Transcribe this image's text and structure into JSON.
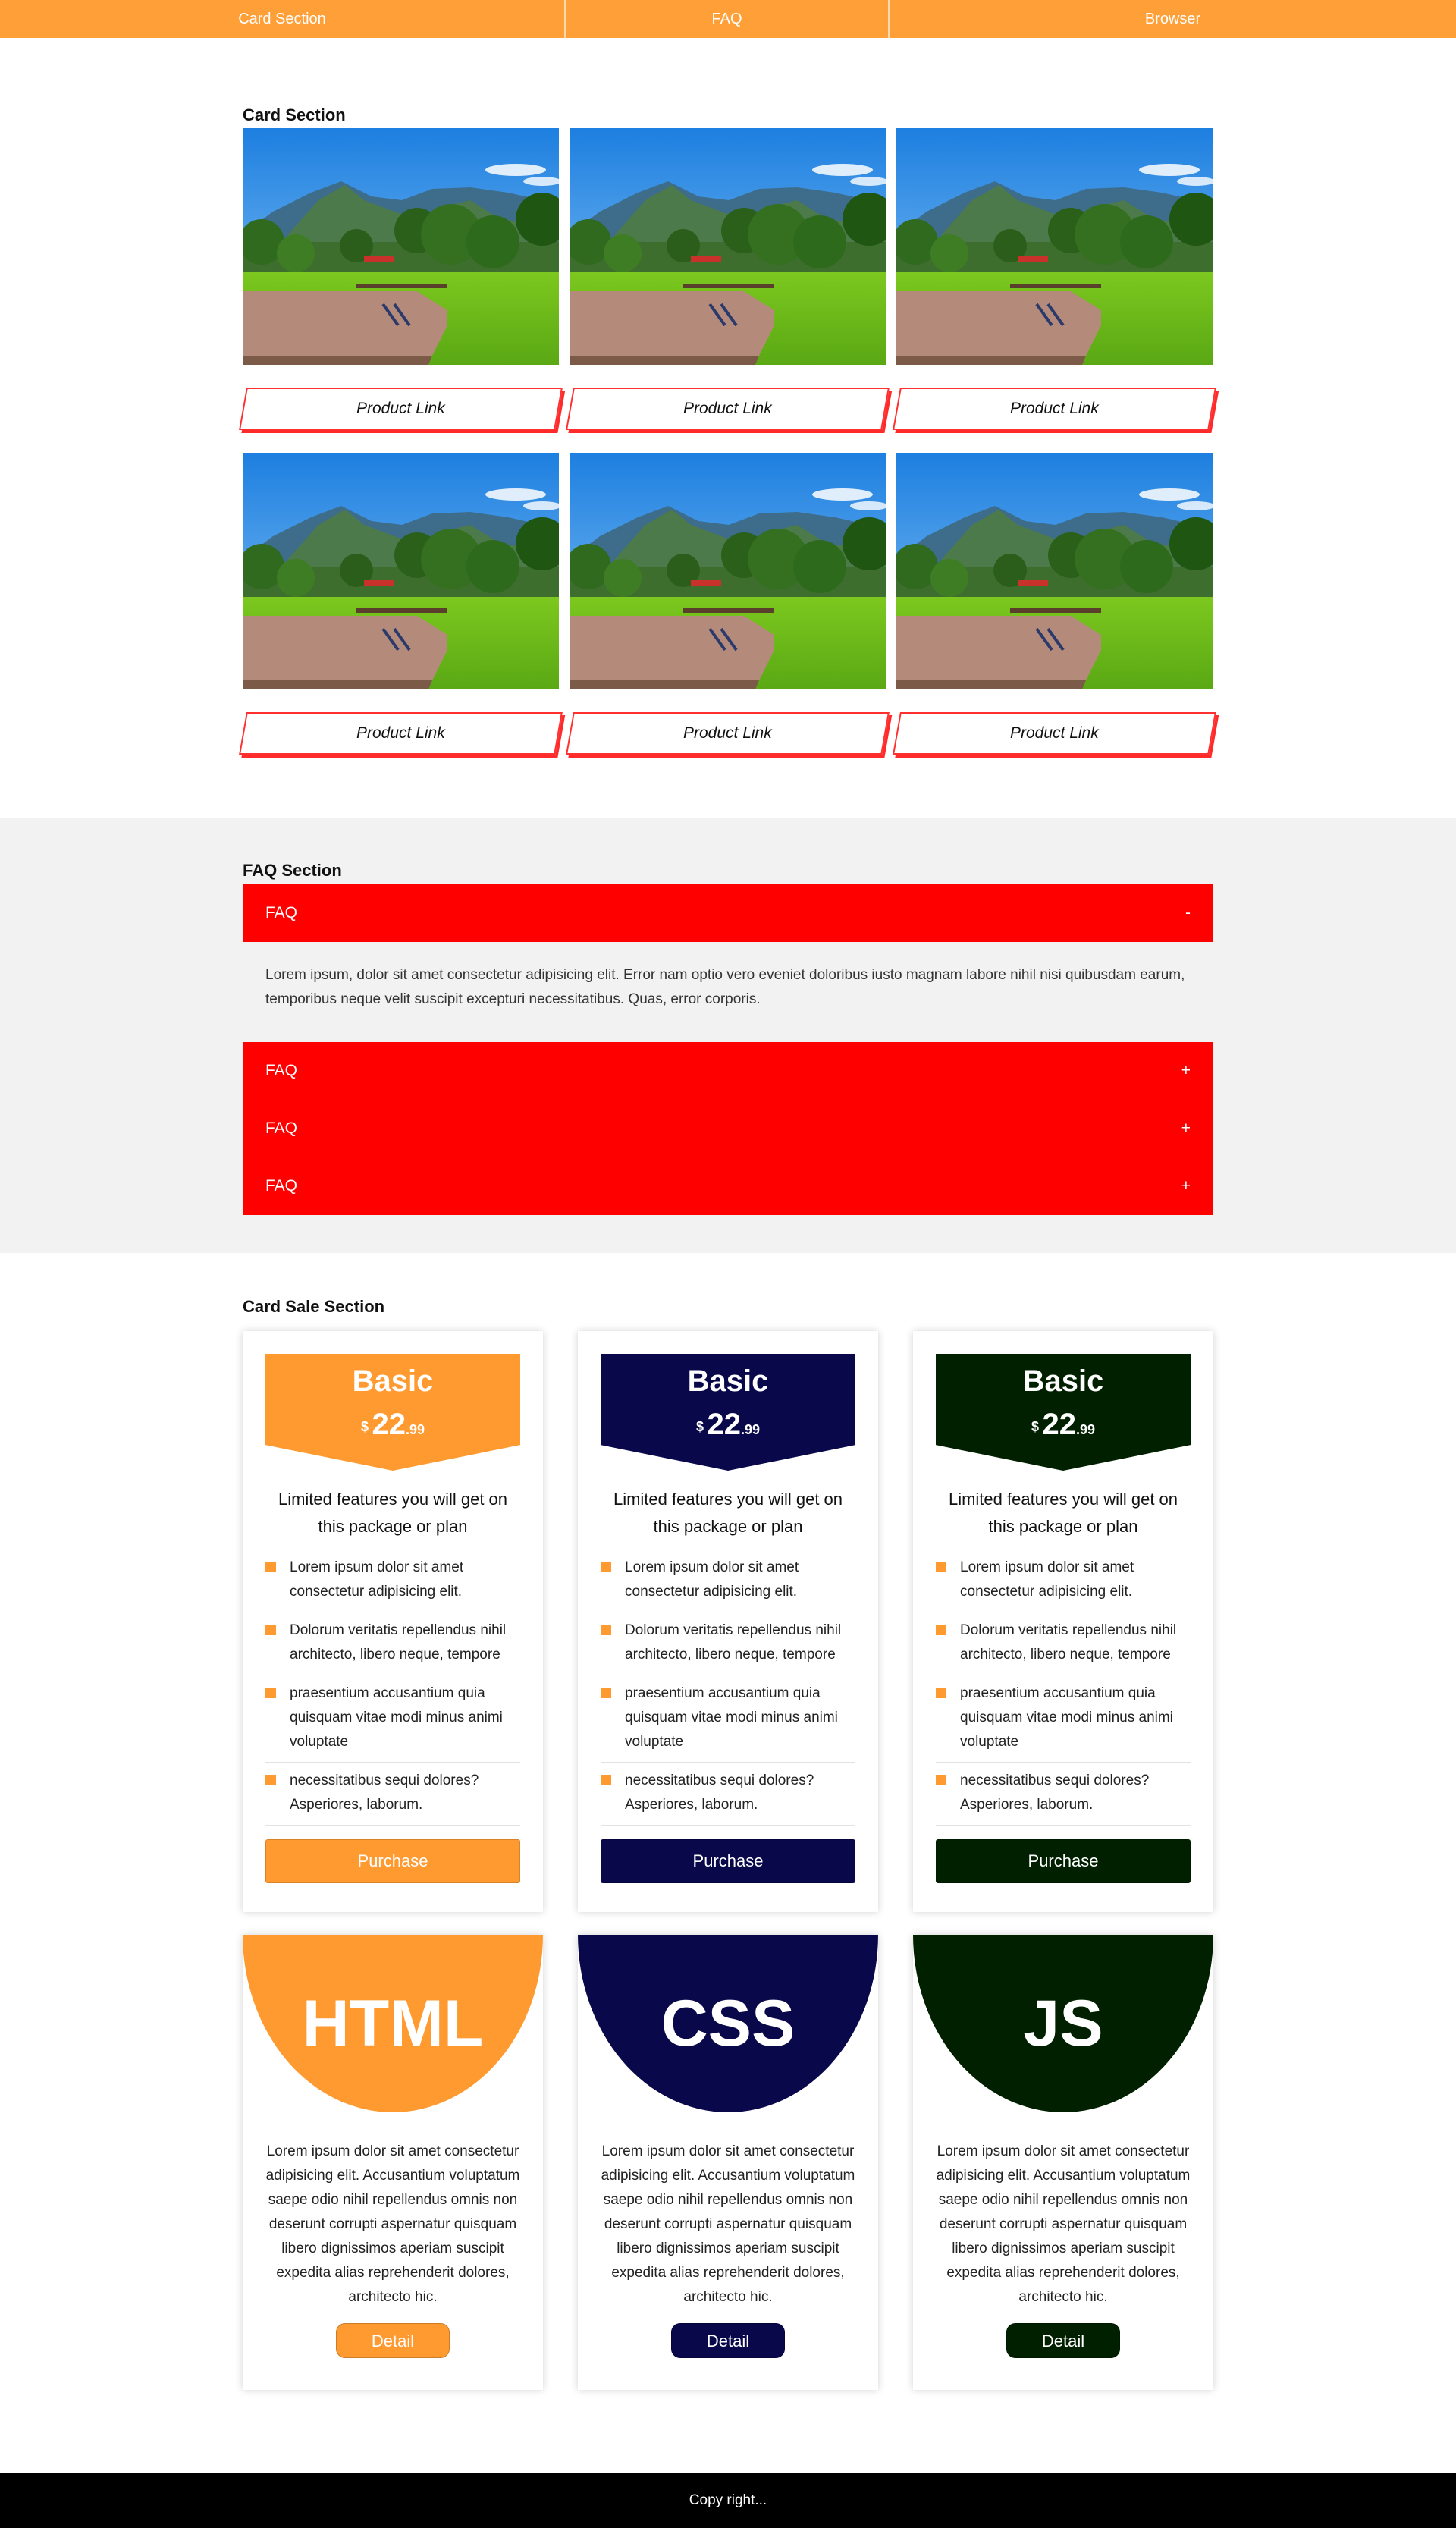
{
  "nav": {
    "items": [
      "Card Section",
      "FAQ",
      "Browser"
    ],
    "color": "#ff9f37"
  },
  "card_section": {
    "title": "Card Section",
    "link_label": "Product Link",
    "cards": [
      {
        "image": "mountain-park-landscape"
      },
      {
        "image": "mountain-park-landscape"
      },
      {
        "image": "mountain-park-landscape"
      },
      {
        "image": "mountain-park-landscape"
      },
      {
        "image": "mountain-park-landscape"
      },
      {
        "image": "mountain-park-landscape"
      }
    ]
  },
  "faq": {
    "title": "FAQ Section",
    "color": "#ff0000",
    "items": [
      {
        "q": "FAQ",
        "toggle": "-",
        "open": true,
        "answer": "Lorem ipsum, dolor sit amet consectetur adipisicing elit. Error nam optio vero eveniet doloribus iusto magnam labore nihil nisi quibusdam earum, temporibus neque velit suscipit excepturi necessitatibus. Quas, error corporis."
      },
      {
        "q": "FAQ",
        "toggle": "+",
        "open": false
      },
      {
        "q": "FAQ",
        "toggle": "+",
        "open": false
      },
      {
        "q": "FAQ",
        "toggle": "+",
        "open": false
      }
    ]
  },
  "sale": {
    "title": "Card Sale Section",
    "plans": [
      {
        "name": "Basic",
        "currency": "$",
        "price": "22",
        "cents": ".99",
        "color": "#ff9a30",
        "desc": "Limited features you will get on this package or plan",
        "button": "Purchase"
      },
      {
        "name": "Basic",
        "currency": "$",
        "price": "22",
        "cents": ".99",
        "color": "#08084a",
        "desc": "Limited features you will get on this package or plan",
        "button": "Purchase"
      },
      {
        "name": "Basic",
        "currency": "$",
        "price": "22",
        "cents": ".99",
        "color": "#002000",
        "desc": "Limited features you will get on this package or plan",
        "button": "Purchase"
      }
    ],
    "features": [
      "Lorem ipsum dolor sit amet consectetur adipisicing elit.",
      "Dolorum veritatis repellendus nihil architecto, libero neque, tempore",
      "praesentium accusantium quia quisquam vitae modi minus animi voluptate",
      "necessitatibus sequi dolores? Asperiores, laborum."
    ],
    "feature_bullet_color": "#ff9a30",
    "tech": [
      {
        "label": "HTML",
        "color": "#ff9a30",
        "button": "Detail",
        "desc": "Lorem ipsum dolor sit amet consectetur adipisicing elit. Accusantium voluptatum saepe odio nihil repellendus omnis non deserunt corrupti aspernatur quisquam libero dignissimos aperiam suscipit expedita alias reprehenderit dolores, architecto hic."
      },
      {
        "label": "CSS",
        "color": "#08084a",
        "button": "Detail",
        "desc": "Lorem ipsum dolor sit amet consectetur adipisicing elit. Accusantium voluptatum saepe odio nihil repellendus omnis non deserunt corrupti aspernatur quisquam libero dignissimos aperiam suscipit expedita alias reprehenderit dolores, architecto hic."
      },
      {
        "label": "JS",
        "color": "#002000",
        "button": "Detail",
        "desc": "Lorem ipsum dolor sit amet consectetur adipisicing elit. Accusantium voluptatum saepe odio nihil repellendus omnis non deserunt corrupti aspernatur quisquam libero dignissimos aperiam suscipit expedita alias reprehenderit dolores, architecto hic."
      }
    ]
  },
  "footer": {
    "text": "Copy right..."
  }
}
